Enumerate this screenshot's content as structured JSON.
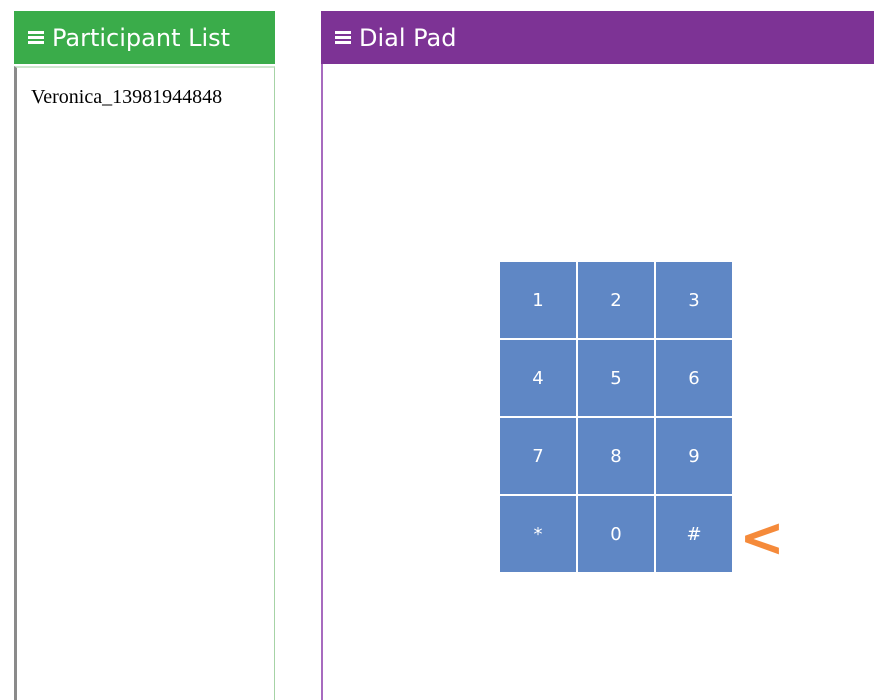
{
  "participant_panel": {
    "title": "Participant List",
    "header_icon": "hamburger-icon",
    "color": "#3aac4a",
    "participants": [
      {
        "name": "Veronica_13981944848"
      }
    ]
  },
  "dialpad_panel": {
    "title": "Dial Pad",
    "header_icon": "hamburger-icon",
    "color": "#7d3395",
    "key_color": "#5f87c5",
    "keys": [
      "1",
      "2",
      "3",
      "4",
      "5",
      "6",
      "7",
      "8",
      "9",
      "*",
      "0",
      "#"
    ],
    "backspace": {
      "label": "<",
      "icon": "backspace-icon",
      "color": "#f58a3a"
    }
  }
}
